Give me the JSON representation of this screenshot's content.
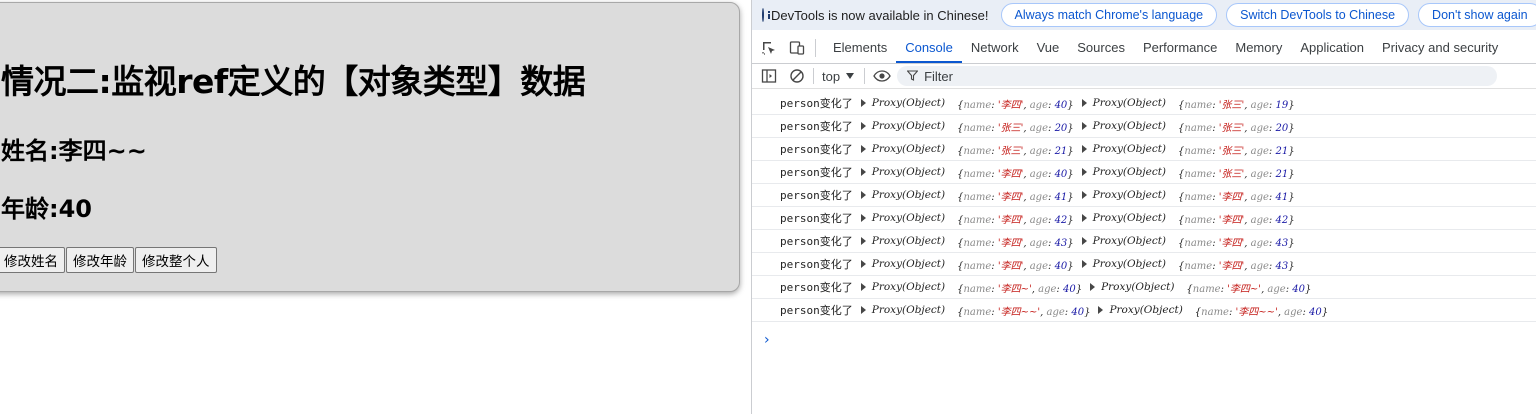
{
  "app": {
    "title": "情况二:监视ref定义的【对象类型】数据",
    "name_line": "姓名:李四~~",
    "age_line": "年龄:40",
    "buttons": [
      "修改姓名",
      "修改年龄",
      "修改整个人"
    ]
  },
  "devtools": {
    "infobar": {
      "text": "DevTools is now available in Chinese!",
      "buttons": [
        "Always match Chrome's language",
        "Switch DevTools to Chinese",
        "Don't show again"
      ]
    },
    "tabs": [
      "Elements",
      "Console",
      "Network",
      "Vue",
      "Sources",
      "Performance",
      "Memory",
      "Application",
      "Privacy and security"
    ],
    "active_tab": "Console",
    "toolbar": {
      "context": "top",
      "filter_placeholder": "Filter"
    },
    "logs": [
      {
        "msg": "person变化了",
        "label1": "Proxy(Object)",
        "name1": "'李四'",
        "age1": "40",
        "label2": "Proxy(Object)",
        "name2": "'张三'",
        "age2": "19"
      },
      {
        "msg": "person变化了",
        "label1": "Proxy(Object)",
        "name1": "'张三'",
        "age1": "20",
        "label2": "Proxy(Object)",
        "name2": "'张三'",
        "age2": "20"
      },
      {
        "msg": "person变化了",
        "label1": "Proxy(Object)",
        "name1": "'张三'",
        "age1": "21",
        "label2": "Proxy(Object)",
        "name2": "'张三'",
        "age2": "21"
      },
      {
        "msg": "person变化了",
        "label1": "Proxy(Object)",
        "name1": "'李四'",
        "age1": "40",
        "label2": "Proxy(Object)",
        "name2": "'张三'",
        "age2": "21"
      },
      {
        "msg": "person变化了",
        "label1": "Proxy(Object)",
        "name1": "'李四'",
        "age1": "41",
        "label2": "Proxy(Object)",
        "name2": "'李四'",
        "age2": "41"
      },
      {
        "msg": "person变化了",
        "label1": "Proxy(Object)",
        "name1": "'李四'",
        "age1": "42",
        "label2": "Proxy(Object)",
        "name2": "'李四'",
        "age2": "42"
      },
      {
        "msg": "person变化了",
        "label1": "Proxy(Object)",
        "name1": "'李四'",
        "age1": "43",
        "label2": "Proxy(Object)",
        "name2": "'李四'",
        "age2": "43"
      },
      {
        "msg": "person变化了",
        "label1": "Proxy(Object)",
        "name1": "'李四'",
        "age1": "40",
        "label2": "Proxy(Object)",
        "name2": "'李四'",
        "age2": "43"
      },
      {
        "msg": "person变化了",
        "label1": "Proxy(Object)",
        "name1": "'李四~'",
        "age1": "40",
        "label2": "Proxy(Object)",
        "name2": "'李四~'",
        "age2": "40"
      },
      {
        "msg": "person变化了",
        "label1": "Proxy(Object)",
        "name1": "'李四~~'",
        "age1": "40",
        "label2": "Proxy(Object)",
        "name2": "'李四~~'",
        "age2": "40"
      }
    ],
    "prompt_symbol": "›"
  }
}
